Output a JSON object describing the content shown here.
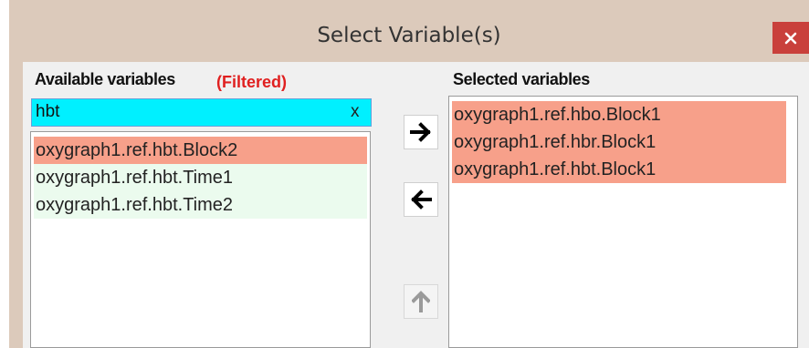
{
  "window": {
    "title": "Select Variable(s)",
    "close_icon": "close-icon",
    "close_color": "#c9403b"
  },
  "available": {
    "label": "Available variables",
    "filtered_label": "(Filtered)",
    "filter_value": "hbt",
    "clear_label": "x",
    "items": [
      "oxygraph1.ref.hbt.Block2",
      "oxygraph1.ref.hbt.Time1",
      "oxygraph1.ref.hbt.Time2"
    ],
    "selected_index": 0
  },
  "transfer": {
    "add_icon": "arrow-right-icon",
    "remove_icon": "arrow-left-icon",
    "move_up_icon": "arrow-up-icon",
    "move_up_enabled": false
  },
  "selected": {
    "label": "Selected variables",
    "items": [
      "oxygraph1.ref.hbo.Block1",
      "oxygraph1.ref.hbr.Block1",
      "oxygraph1.ref.hbt.Block1"
    ]
  },
  "colors": {
    "selected_item": "#f7a08a",
    "unselected_item": "#ebfbee",
    "filter_background": "#00f0ff",
    "filtered_label": "#e02020"
  }
}
